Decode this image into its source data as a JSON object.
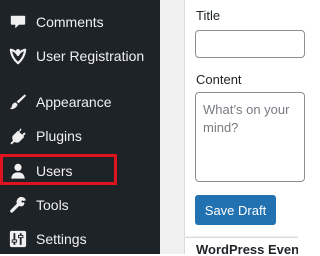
{
  "sidebar": {
    "items": [
      {
        "id": "comments",
        "label": "Comments",
        "icon": "comment-icon"
      },
      {
        "id": "user-registration",
        "label": "User Registration",
        "icon": "user-registration-icon"
      },
      {
        "id": "appearance",
        "label": "Appearance",
        "icon": "paintbrush-icon"
      },
      {
        "id": "plugins",
        "label": "Plugins",
        "icon": "plug-icon"
      },
      {
        "id": "users",
        "label": "Users",
        "icon": "user-icon"
      },
      {
        "id": "tools",
        "label": "Tools",
        "icon": "wrench-icon"
      },
      {
        "id": "settings",
        "label": "Settings",
        "icon": "sliders-icon"
      }
    ],
    "highlighted_item": "users"
  },
  "quick_draft": {
    "title_label": "Title",
    "title_value": "",
    "content_label": "Content",
    "content_placeholder": "What’s on your mind?",
    "save_label": "Save Draft"
  },
  "next_section": {
    "title": "WordPress Events and News"
  },
  "colors": {
    "sidebar_bg": "#1d2327",
    "sidebar_text": "#f0f0f1",
    "highlight": "#e0141e",
    "primary_button": "#2271b1",
    "content_bg": "#f0f0f1"
  }
}
